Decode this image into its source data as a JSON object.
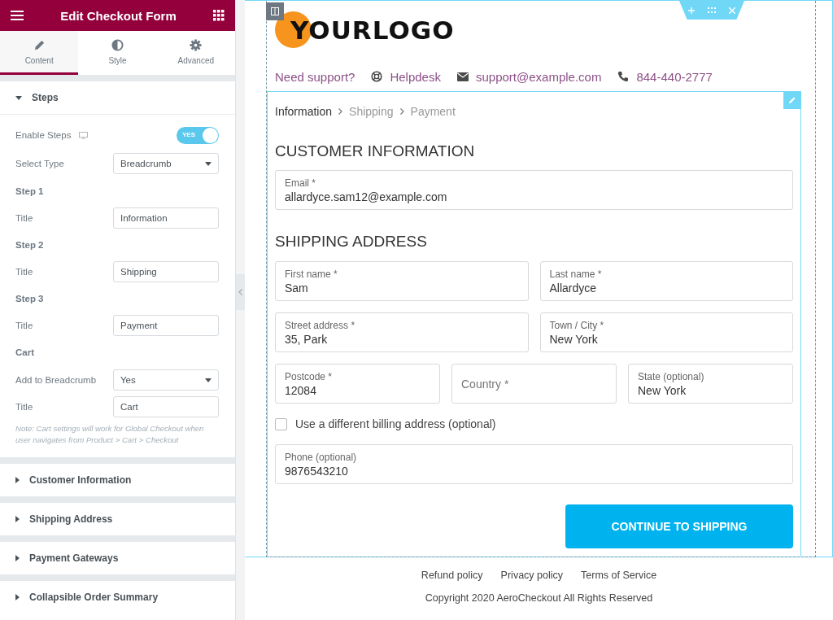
{
  "panel": {
    "title": "Edit Checkout Form",
    "tabs": [
      {
        "label": "Content",
        "selected": true
      },
      {
        "label": "Style",
        "selected": false
      },
      {
        "label": "Advanced",
        "selected": false
      }
    ],
    "sections": [
      {
        "title": "Steps",
        "expanded": true,
        "controls": [
          {
            "kind": "toggle",
            "label": "Enable Steps",
            "responsive": true,
            "on": true,
            "text": "YES"
          },
          {
            "kind": "select",
            "label": "Select Type",
            "value": "Breadcrumb"
          },
          {
            "kind": "heading",
            "label": "Step 1"
          },
          {
            "kind": "text",
            "label": "Title",
            "value": "Information"
          },
          {
            "kind": "heading",
            "label": "Step 2"
          },
          {
            "kind": "text",
            "label": "Title",
            "value": "Shipping"
          },
          {
            "kind": "heading",
            "label": "Step 3"
          },
          {
            "kind": "text",
            "label": "Title",
            "value": "Payment"
          },
          {
            "kind": "heading",
            "label": "Cart"
          },
          {
            "kind": "select",
            "label": "Add to Breadcrumb",
            "value": "Yes"
          },
          {
            "kind": "text",
            "label": "Title",
            "value": "Cart"
          },
          {
            "kind": "note",
            "label": "Note: Cart settings will work for Global Checkout when user navigates from Product > Cart > Checkout"
          }
        ]
      },
      {
        "title": "Customer Information",
        "expanded": false
      },
      {
        "title": "Shipping Address",
        "expanded": false
      },
      {
        "title": "Payment Gateways",
        "expanded": false
      },
      {
        "title": "Collapsible Order Summary",
        "expanded": false
      }
    ]
  },
  "preview": {
    "logo": "YOURLOGO",
    "support": {
      "label": "Need support?",
      "links": [
        "Helpdesk",
        "support@example.com",
        "844-440-2777"
      ]
    },
    "breadcrumb": [
      {
        "label": "Information",
        "selected": true
      },
      {
        "label": "Shipping",
        "selected": false
      },
      {
        "label": "Payment",
        "selected": false
      }
    ],
    "sections": [
      {
        "heading": "CUSTOMER INFORMATION",
        "rows": [
          [
            {
              "label": "Email *",
              "value": "allardyce.sam12@example.com"
            }
          ]
        ]
      },
      {
        "heading": "SHIPPING ADDRESS",
        "rows": [
          [
            {
              "label": "First name *",
              "value": "Sam"
            },
            {
              "label": "Last name *",
              "value": "Allardyce"
            }
          ],
          [
            {
              "label": "Street address *",
              "value": "35, Park"
            },
            {
              "label": "Town / City *",
              "value": "New York"
            }
          ],
          [
            {
              "label": "Postcode *",
              "value": "12084"
            },
            {
              "label": "Country *"
            },
            {
              "label": "State (optional)",
              "value": "New York"
            }
          ]
        ]
      }
    ],
    "billing": {
      "label": "Use a different billing address (optional)",
      "checked": false
    },
    "phone": {
      "label": "Phone (optional)",
      "value": "9876543210"
    },
    "button": "CONTINUE TO SHIPPING",
    "footer": {
      "links": [
        "Refund policy",
        "Privacy policy",
        "Terms of Service"
      ],
      "copyright": "Copyright 2020 AeroCheckout All Rights Reserved"
    }
  }
}
